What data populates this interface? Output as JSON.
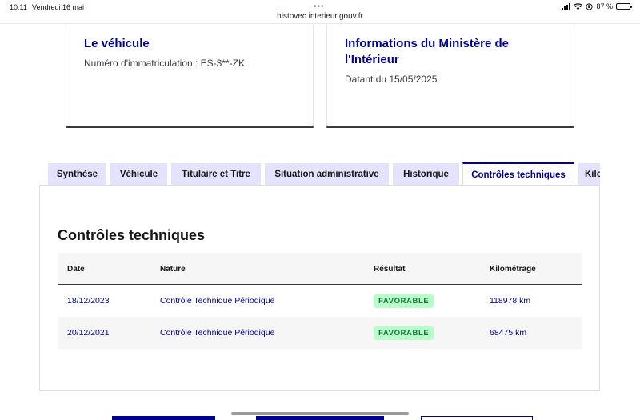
{
  "statusbar": {
    "time": "10:11",
    "date": "Vendredi 16 mai",
    "url": "histovec.interieur.gouv.fr",
    "battery": "87 %",
    "battery_level": 0.87
  },
  "cards": {
    "vehicle": {
      "title": "Le véhicule",
      "text": "Numéro d'immatriculation : ES-3**-ZK"
    },
    "ministry": {
      "title": "Informations du Ministère de l'Intérieur",
      "text": "Datant du 15/05/2025"
    }
  },
  "tabs": [
    {
      "label": "Synthèse"
    },
    {
      "label": "Véhicule"
    },
    {
      "label": "Titulaire et Titre"
    },
    {
      "label": "Situation administrative"
    },
    {
      "label": "Historique"
    },
    {
      "label": "Contrôles techniques",
      "active": true
    },
    {
      "label": "Kilo"
    }
  ],
  "panel": {
    "title": "Contrôles techniques",
    "columns": {
      "date": "Date",
      "nature": "Nature",
      "result": "Résultat",
      "mileage": "Kilométrage"
    },
    "rows": [
      {
        "date": "18/12/2023",
        "nature": "Contrôle Technique Périodique",
        "result": "FAVORABLE",
        "mileage": "118978 km"
      },
      {
        "date": "20/12/2021",
        "nature": "Contrôle Technique Périodique",
        "result": "FAVORABLE",
        "mileage": "68475 km"
      }
    ]
  },
  "colors": {
    "primary": "#000091",
    "tab_bg": "#e3e3fd",
    "badge_bg": "#b8fec9",
    "badge_text": "#18753c"
  },
  "icons": [
    "wifi-icon",
    "signal-icon",
    "battery-icon",
    "orientation-lock-icon",
    "more-dots-icon"
  ]
}
